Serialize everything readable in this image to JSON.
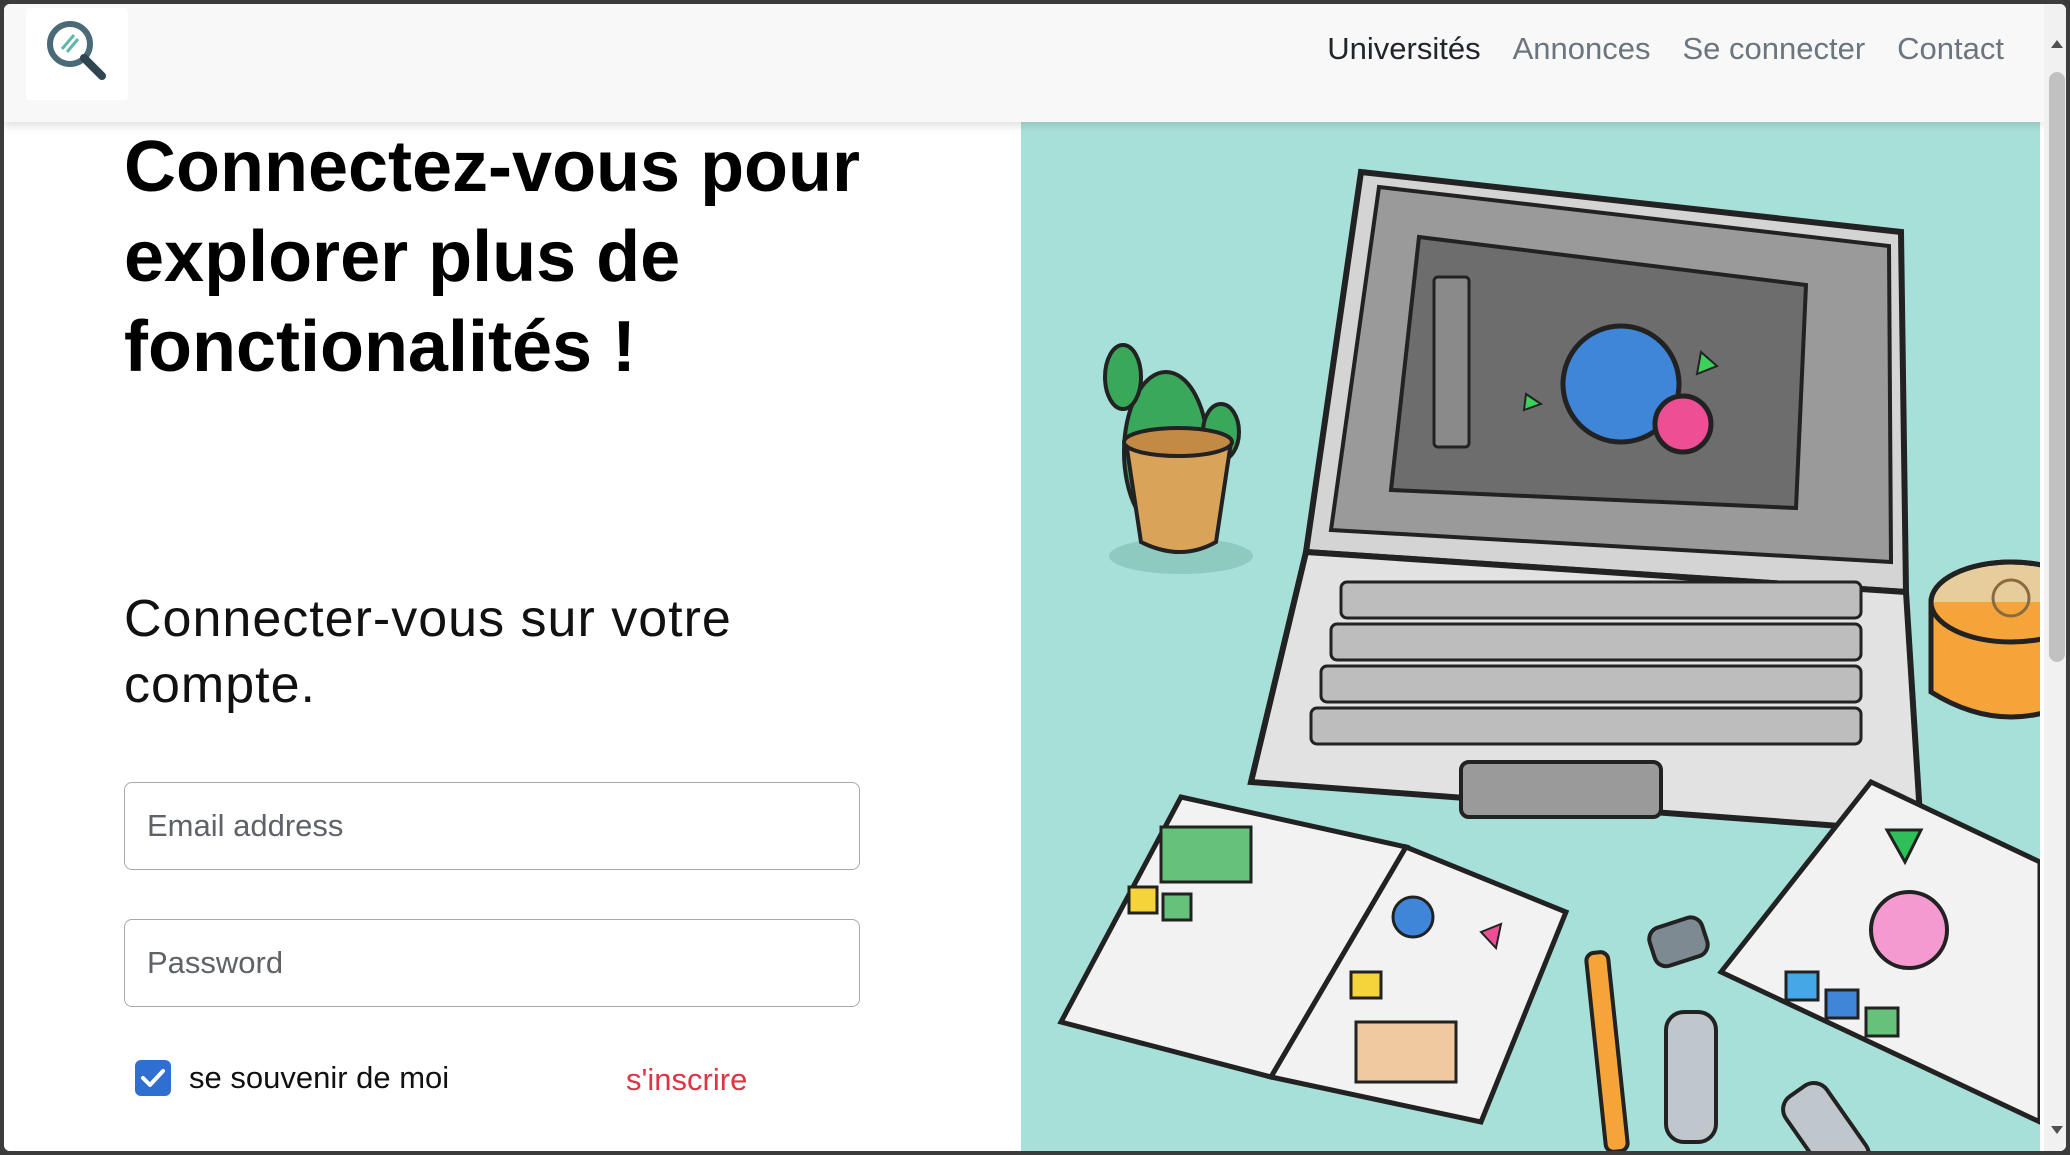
{
  "navbar": {
    "logo_icon": "magnifier-logo-icon",
    "links": [
      {
        "label": "Universités",
        "active": true
      },
      {
        "label": "Annonces",
        "active": false
      },
      {
        "label": "Se connecter",
        "active": false
      },
      {
        "label": "Contact",
        "active": false
      }
    ]
  },
  "main": {
    "title": "Connectez-vous pour explorer plus de fonctionalités !",
    "subtitle": "Connecter-vous sur votre compte.",
    "email_placeholder": "Email address",
    "email_value": "",
    "password_placeholder": "Password",
    "password_value": "",
    "remember_label": "se souvenir de moi",
    "remember_checked": true,
    "signup_label": "s'inscrire"
  },
  "colors": {
    "accent_blue": "#2f6fd1",
    "signup_red": "#dc3545",
    "illustration_bg": "#a7e0d8"
  }
}
